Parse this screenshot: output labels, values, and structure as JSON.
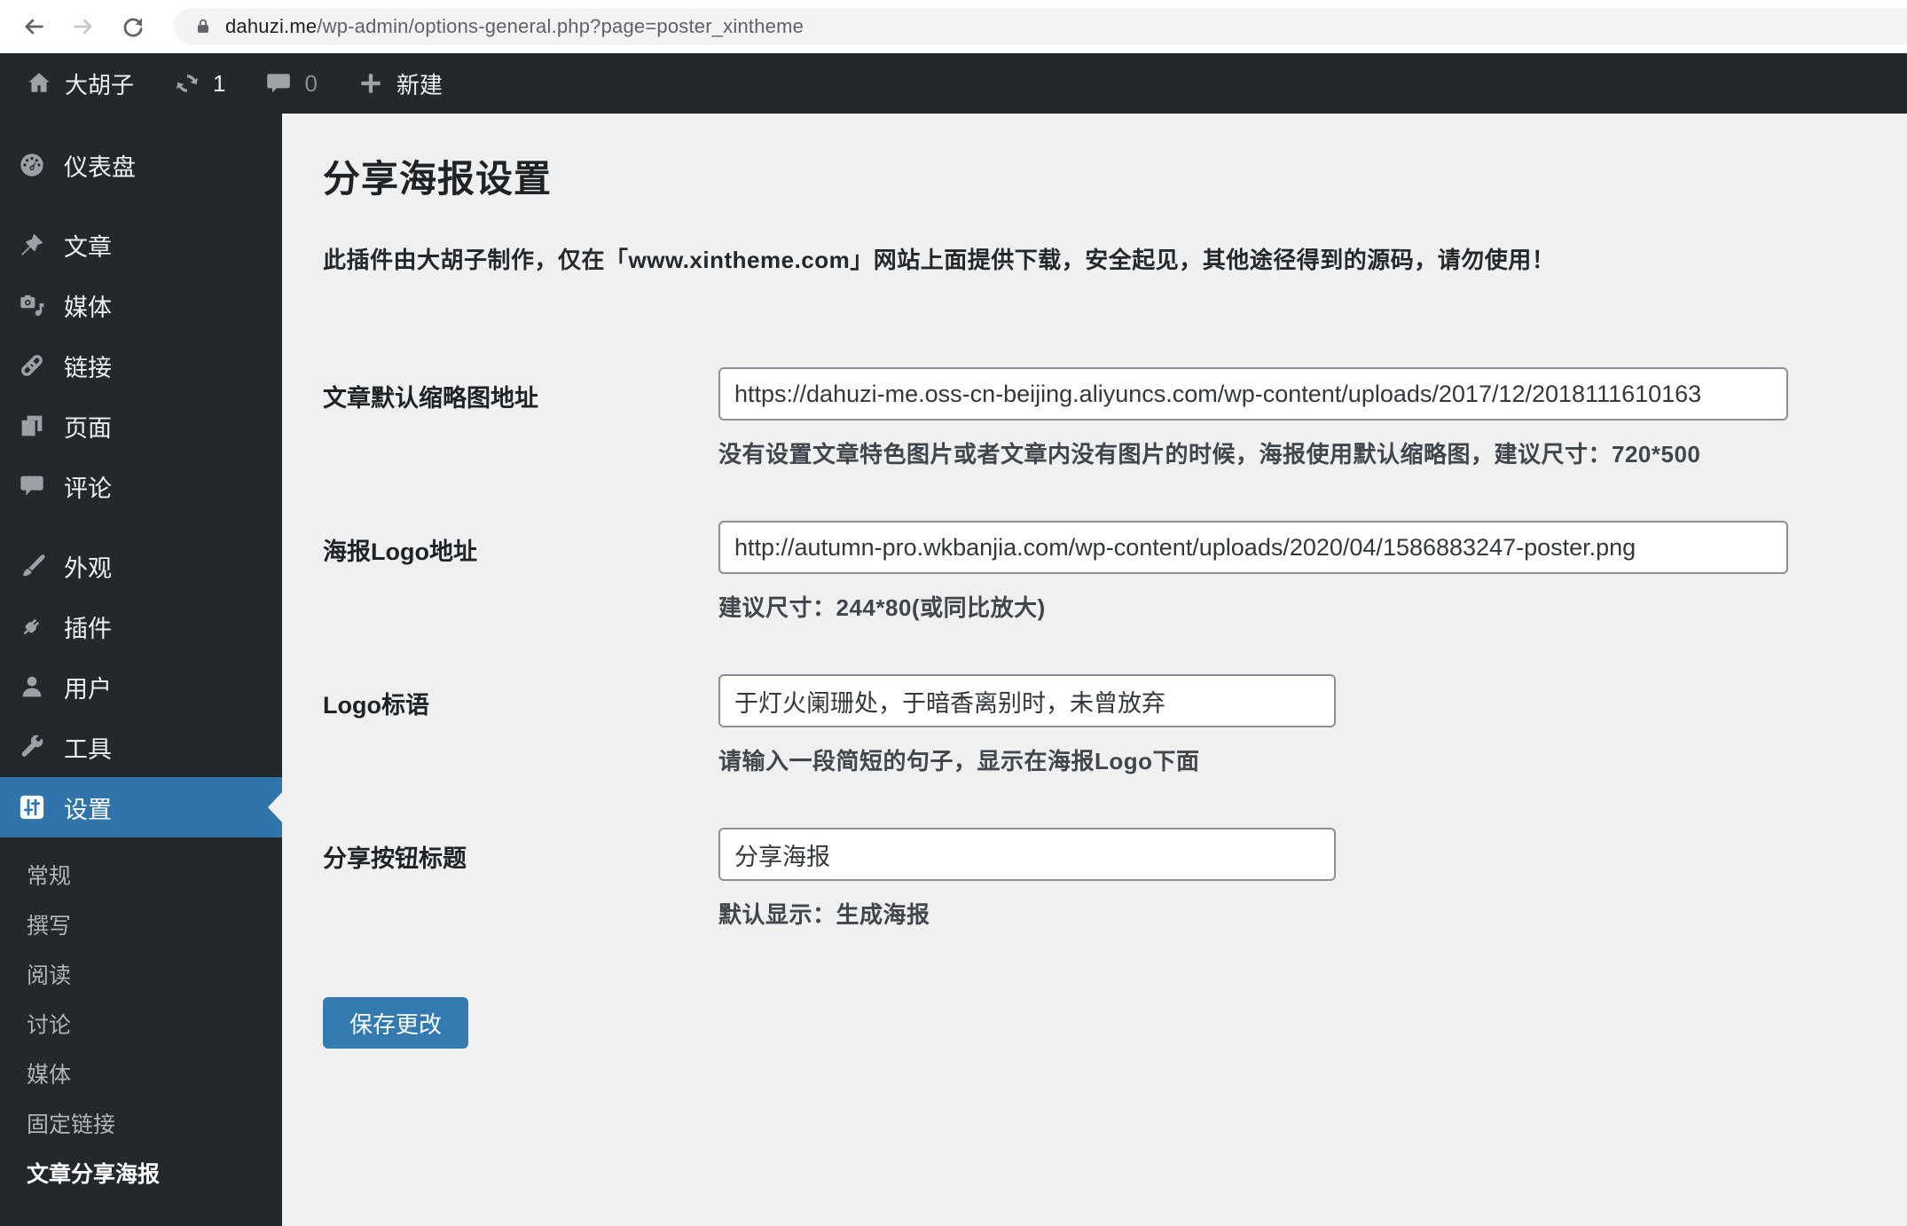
{
  "browser": {
    "url_domain": "dahuzi.me",
    "url_path": "/wp-admin/options-general.php?page=poster_xintheme"
  },
  "admin_bar": {
    "site_name": "大胡子",
    "update_count": "1",
    "comment_count": "0",
    "new_label": "新建"
  },
  "sidebar": {
    "items": [
      {
        "label": "仪表盘",
        "icon": "dashboard-icon"
      },
      {
        "label": "文章",
        "icon": "pushpin-icon"
      },
      {
        "label": "媒体",
        "icon": "media-icon"
      },
      {
        "label": "链接",
        "icon": "link-icon"
      },
      {
        "label": "页面",
        "icon": "pages-icon"
      },
      {
        "label": "评论",
        "icon": "comment-icon"
      },
      {
        "label": "外观",
        "icon": "brush-icon"
      },
      {
        "label": "插件",
        "icon": "plugin-icon"
      },
      {
        "label": "用户",
        "icon": "user-icon"
      },
      {
        "label": "工具",
        "icon": "wrench-icon"
      },
      {
        "label": "设置",
        "icon": "sliders-icon"
      }
    ],
    "submenu": [
      {
        "label": "常规"
      },
      {
        "label": "撰写"
      },
      {
        "label": "阅读"
      },
      {
        "label": "讨论"
      },
      {
        "label": "媒体"
      },
      {
        "label": "固定链接"
      },
      {
        "label": "文章分享海报"
      }
    ]
  },
  "main": {
    "title": "分享海报设置",
    "notice": "此插件由大胡子制作，仅在「www.xintheme.com」网站上面提供下载，安全起见，其他途径得到的源码，请勿使用！",
    "fields": [
      {
        "label": "文章默认缩略图地址",
        "value": "https://dahuzi-me.oss-cn-beijing.aliyuncs.com/wp-content/uploads/2017/12/2018111610163",
        "help": "没有设置文章特色图片或者文章内没有图片的时候，海报使用默认缩略图，建议尺寸：720*500"
      },
      {
        "label": "海报Logo地址",
        "value": "http://autumn-pro.wkbanjia.com/wp-content/uploads/2020/04/1586883247-poster.png",
        "help": "建议尺寸：244*80(或同比放大)"
      },
      {
        "label": "Logo标语",
        "value": "于灯火阑珊处，于暗香离别时，未曾放弃",
        "help": "请输入一段简短的句子，显示在海报Logo下面"
      },
      {
        "label": "分享按钮标题",
        "value": "分享海报",
        "help": "默认显示：生成海报"
      }
    ],
    "save_label": "保存更改"
  },
  "colors": {
    "sidebar_bg": "#23282d",
    "active_blue": "#3174ab",
    "button_blue": "#337ab1",
    "content_bg": "#f0f0f1"
  }
}
